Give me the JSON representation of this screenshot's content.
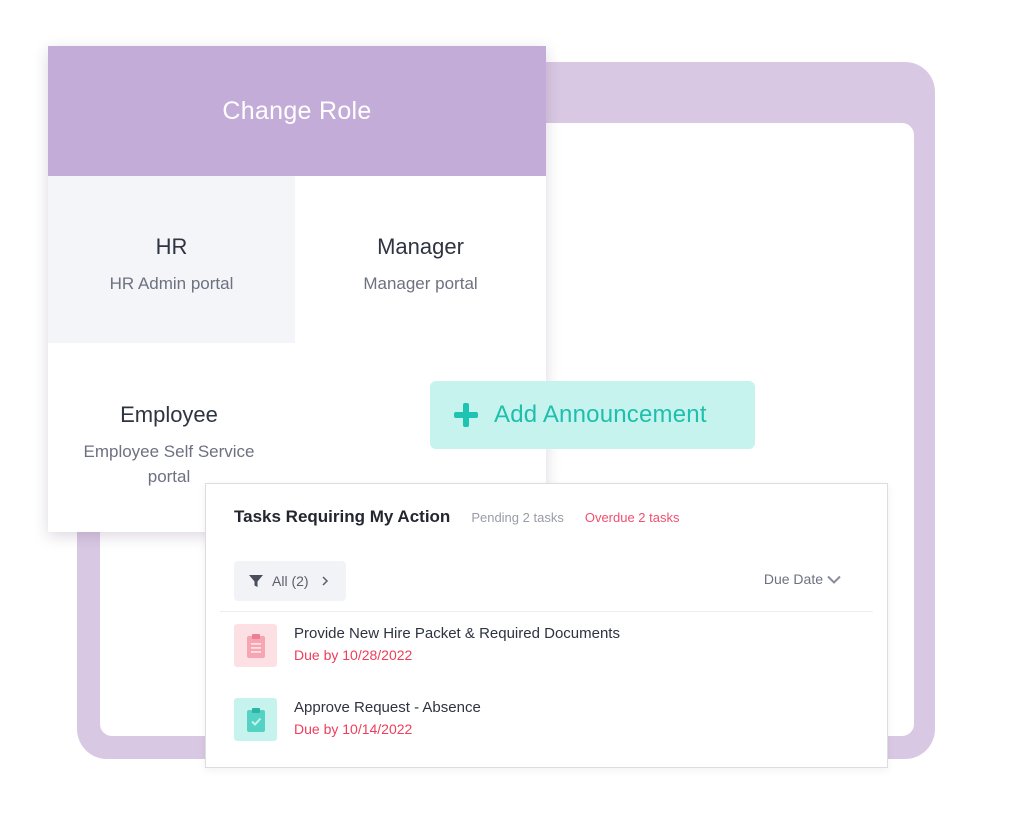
{
  "change_role": {
    "title": "Change Role",
    "options": [
      {
        "name": "HR",
        "description": "HR Admin portal"
      },
      {
        "name": "Manager",
        "description": "Manager portal"
      },
      {
        "name": "Employee",
        "description": "Employee Self Service portal"
      }
    ]
  },
  "announcement": {
    "label": "Add Announcement",
    "icon": "plus-icon"
  },
  "tasks": {
    "title": "Tasks Requiring My Action",
    "pending": "Pending 2 tasks",
    "overdue": "Overdue 2 tasks",
    "filter_label": "All (2)",
    "sort_label": "Due Date",
    "items": [
      {
        "name": "Provide New Hire Packet & Required Documents",
        "due": "Due by 10/28/2022",
        "icon": "clipboard-list-icon"
      },
      {
        "name": "Approve Request - Absence",
        "due": "Due by 10/14/2022",
        "icon": "clipboard-check-icon"
      }
    ]
  },
  "colors": {
    "frame_purple": "#d9c8e3",
    "header_purple": "#c4acd8",
    "accent_teal": "#1fc3b2",
    "teal_bg": "#c6f3ee",
    "overdue_red": "#ef3d5a",
    "pink_bg": "#fde0e4"
  }
}
